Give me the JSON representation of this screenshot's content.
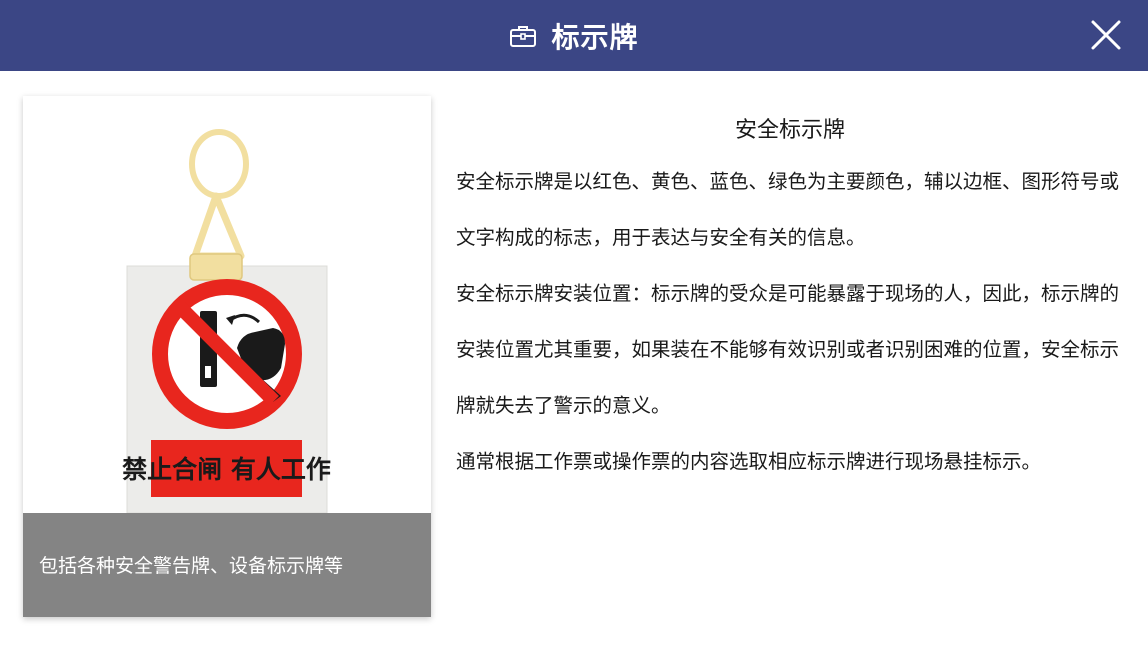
{
  "header": {
    "title": "标示牌",
    "icon": "briefcase-icon",
    "close_icon": "close-icon",
    "background": "#3b4685"
  },
  "card": {
    "caption": "包括各种安全警告牌、设备标示牌等",
    "sign_text": "禁止合闸 有人工作",
    "caption_background": "#848484",
    "sign_red": "#e8261e"
  },
  "content": {
    "title": "安全标示牌",
    "paragraphs": [
      "安全标示牌是以红色、黄色、蓝色、绿色为主要颜色，辅以边框、图形符号或文字构成的标志，用于表达与安全有关的信息。",
      "安全标示牌安装位置：标示牌的受众是可能暴露于现场的人，因此，标示牌的安装位置尤其重要，如果装在不能够有效识别或者识别困难的位置，安全标示牌就失去了警示的意义。",
      "通常根据工作票或操作票的内容选取相应标示牌进行现场悬挂标示。"
    ]
  }
}
